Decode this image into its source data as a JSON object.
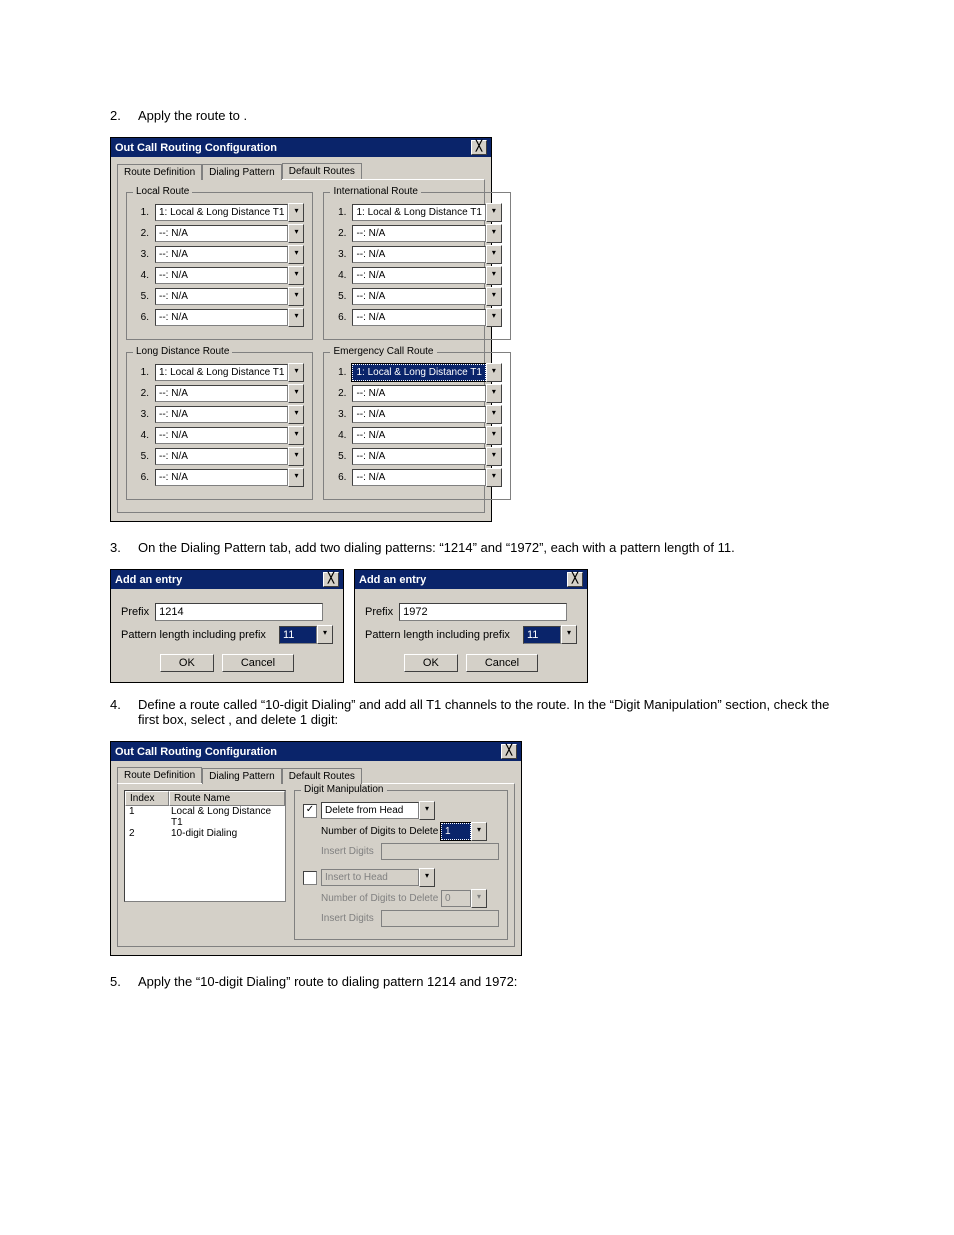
{
  "steps": {
    "s2_num": "2.",
    "s2_text": "Apply the route to                               .",
    "s3_num": "3.",
    "s3_text": "On the Dialing Pattern tab, add two dialing patterns: “1214” and “1972”, each with a pattern length of 11.",
    "s4_num": "4.",
    "s4_text": "Define a route called “10-digit Dialing” and add all T1 channels to the route. In the “Digit Manipulation” section, check the first box, select                               , and delete 1 digit:",
    "s5_num": "5.",
    "s5_text": "Apply the “10-digit Dialing” route to dialing pattern 1214 and 1972:"
  },
  "win1": {
    "title": "Out Call Routing Configuration",
    "tabs": {
      "t1": "Route Definition",
      "t2": "Dialing Pattern",
      "t3": "Default Routes"
    },
    "groups": {
      "local": "Local Route",
      "intl": "International Route",
      "ld": "Long Distance Route",
      "emerg": "Emergency Call Route"
    },
    "route_primary": "1: Local & Long Distance T1",
    "route_na": "--: N/A",
    "idx": [
      "1.",
      "2.",
      "3.",
      "4.",
      "5.",
      "6."
    ]
  },
  "dlg": {
    "title": "Add an entry",
    "prefix_label": "Prefix",
    "len_label": "Pattern length including prefix",
    "len_value": "11",
    "ok": "OK",
    "cancel": "Cancel",
    "prefix1": "1214",
    "prefix2": "1972"
  },
  "win2": {
    "title": "Out Call Routing Configuration",
    "tabs": {
      "t1": "Route Definition",
      "t2": "Dialing Pattern",
      "t3": "Default Routes"
    },
    "list": {
      "h_index": "Index",
      "h_name": "Route Name",
      "r1_idx": "1",
      "r1_name": "Local & Long Distance T1",
      "r2_idx": "2",
      "r2_name": "10-digit Dialing"
    },
    "dm": {
      "group": "Digit Manipulation",
      "delete_from": "Delete from Head",
      "num_delete": "Number of Digits to Delete",
      "num_delete_val": "1",
      "insert_digits": "Insert Digits",
      "insert_to": "Insert to Head",
      "num_delete2": "Number of Digits to Delete",
      "num_delete2_val": "0",
      "insert_digits2": "Insert Digits"
    }
  },
  "glyphs": {
    "close": "╳",
    "down": "▾",
    "check": "✓"
  }
}
